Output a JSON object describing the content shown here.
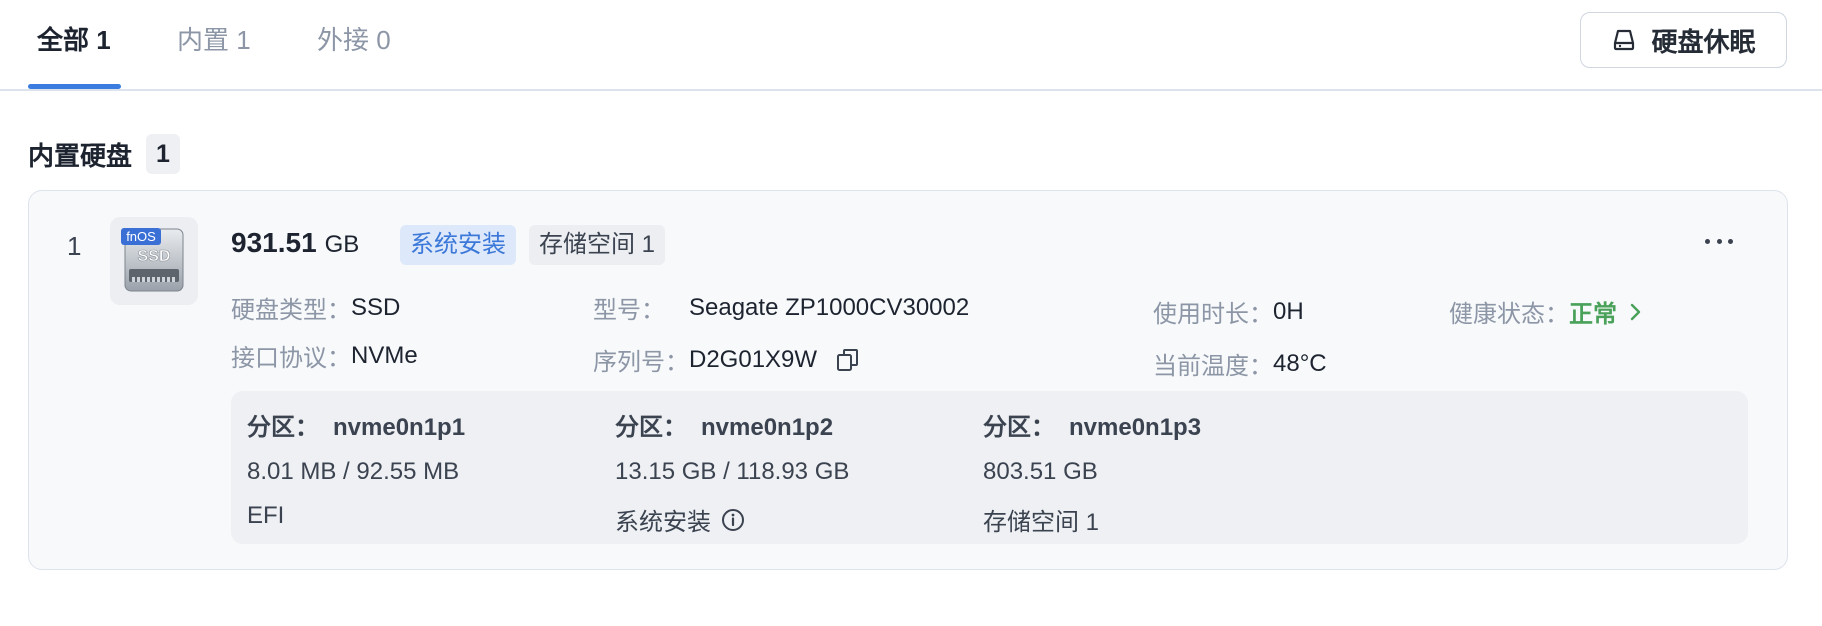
{
  "tabs": [
    {
      "label": "全部 1",
      "active": true
    },
    {
      "label": "内置 1",
      "active": false
    },
    {
      "label": "外接 0",
      "active": false
    }
  ],
  "sleep_button": {
    "label": "硬盘休眠",
    "icon": "drive-icon"
  },
  "section": {
    "title": "内置硬盘",
    "count": "1"
  },
  "disk": {
    "index": "1",
    "icon_badge": "fnOS",
    "icon_label": "SSD",
    "capacity_value": "931.51",
    "capacity_unit": "GB",
    "tags": [
      "系统安装",
      "存储空间 1"
    ],
    "fields": {
      "type_label": "硬盘类型：",
      "type_value": "SSD",
      "model_label": "型号：",
      "model_value": "Seagate ZP1000CV30002",
      "uptime_label": "使用时长：",
      "uptime_value": "0H",
      "health_label": "健康状态：",
      "health_value": "正常",
      "interface_label": "接口协议：",
      "interface_value": "NVMe",
      "serial_label": "序列号：",
      "serial_value": "D2G01X9W",
      "temp_label": "当前温度：",
      "temp_value": "48°C"
    },
    "partitions": [
      {
        "label": "分区：",
        "name": "nvme0n1p1",
        "usage": "8.01 MB / 92.55 MB",
        "type": "EFI",
        "info": false
      },
      {
        "label": "分区：",
        "name": "nvme0n1p2",
        "usage": "13.15 GB / 118.93 GB",
        "type": "系统安装",
        "info": true
      },
      {
        "label": "分区：",
        "name": "nvme0n1p3",
        "usage": "803.51 GB",
        "type": "存储空间 1",
        "info": false
      }
    ]
  },
  "colors": {
    "accent": "#3a7ce0",
    "healthy": "#49a15a",
    "tag_blue_bg": "#dde8fb"
  }
}
